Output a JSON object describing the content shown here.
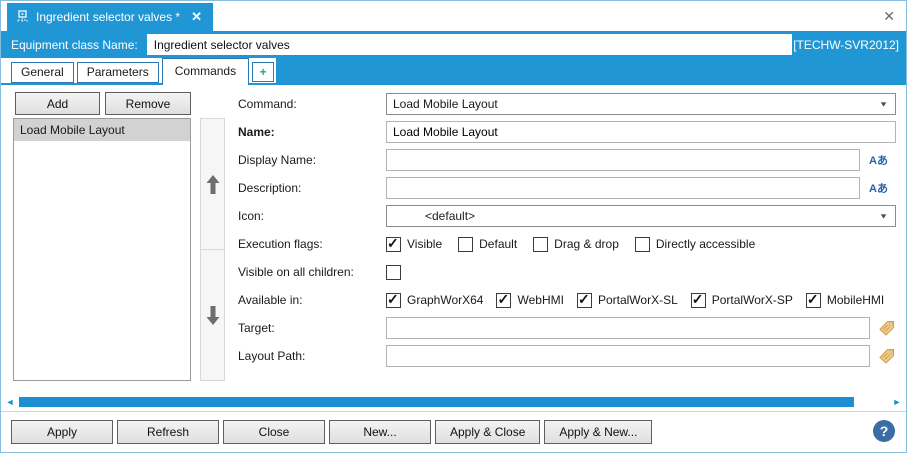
{
  "colors": {
    "accent_blue": "#2196d5",
    "tab_border": "#2a79b5",
    "scrollbar_blue": "#1b8fd2",
    "plus_green": "#2f9e8f",
    "localize_blue": "#2263ae",
    "tag_gold": "#f0cb8b",
    "help_blue": "#3a6ca6",
    "selected_item_gray": "#d2d2d2"
  },
  "window": {
    "doc_tab_title": "Ingredient selector valves *",
    "doc_tab_close_glyph": "✕",
    "window_close_glyph": "✕"
  },
  "header": {
    "label": "Equipment class Name:",
    "value": "Ingredient selector valves",
    "server": "[TECHW-SVR2012]"
  },
  "tabs": {
    "items": [
      {
        "label": "General",
        "active": false
      },
      {
        "label": "Parameters",
        "active": false
      },
      {
        "label": "Commands",
        "active": true
      }
    ],
    "add_tab_glyph": "+"
  },
  "commands_panel": {
    "add_label": "Add",
    "remove_label": "Remove",
    "items": [
      "Load Mobile Layout"
    ],
    "selected_index": 0
  },
  "form": {
    "command": {
      "label": "Command:",
      "value": "Load Mobile Layout"
    },
    "name": {
      "label": "Name:",
      "value": "Load Mobile Layout"
    },
    "display_name": {
      "label": "Display Name:",
      "value": "",
      "localize_glyph": "Aあ"
    },
    "description": {
      "label": "Description:",
      "value": "",
      "localize_glyph": "Aあ"
    },
    "icon": {
      "label": "Icon:",
      "value": "<default>"
    },
    "execution_flags": {
      "label": "Execution flags:",
      "options": [
        {
          "label": "Visible",
          "checked": true
        },
        {
          "label": "Default",
          "checked": false
        },
        {
          "label": "Drag & drop",
          "checked": false
        },
        {
          "label": "Directly accessible",
          "checked": false
        }
      ]
    },
    "visible_on_all_children": {
      "label": "Visible on all children:",
      "checked": false
    },
    "available_in": {
      "label": "Available in:",
      "options": [
        {
          "label": "GraphWorX64",
          "checked": true
        },
        {
          "label": "WebHMI",
          "checked": true
        },
        {
          "label": "PortalWorX-SL",
          "checked": true
        },
        {
          "label": "PortalWorX-SP",
          "checked": true
        },
        {
          "label": "MobileHMI",
          "checked": true
        }
      ]
    },
    "target": {
      "label": "Target:",
      "value": ""
    },
    "layout_path": {
      "label": "Layout Path:",
      "value": ""
    }
  },
  "glyphs": {
    "dropdown_arrow": "▼",
    "scroll_left": "◄",
    "scroll_right": "►"
  },
  "footer": {
    "buttons": [
      "Apply",
      "Refresh",
      "Close",
      "New...",
      "Apply & Close",
      "Apply & New..."
    ],
    "help_glyph": "?"
  }
}
